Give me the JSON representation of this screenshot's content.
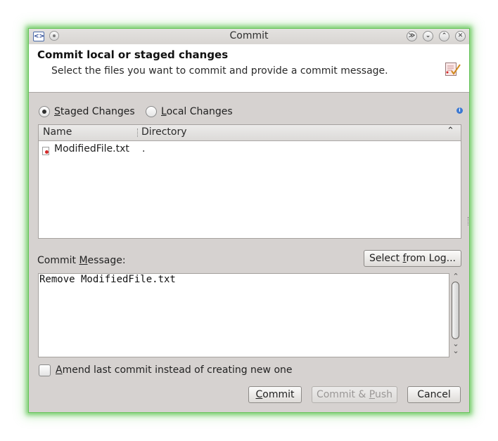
{
  "window": {
    "title": "Commit",
    "app_icon": "<>",
    "controls": {
      "keep_above": "≫",
      "keep_below": "⌄",
      "maximize": "⌃",
      "close": "✕"
    }
  },
  "header": {
    "title": "Commit local or staged changes",
    "description": "Select the files you want to commit and provide a commit message.",
    "icon": "commit-pen-icon"
  },
  "mode": {
    "staged": {
      "mnemonic": "S",
      "rest": "taged Changes",
      "checked": true
    },
    "local": {
      "mnemonic": "L",
      "rest": "ocal Changes",
      "checked": false
    },
    "info_icon": "i"
  },
  "files": {
    "columns": [
      "Name",
      "Directory"
    ],
    "sort_icon": "⌃",
    "rows": [
      {
        "name": "ModifiedFile.txt",
        "directory": "."
      }
    ]
  },
  "message": {
    "label_pre": "Commit ",
    "label_mnemonic": "M",
    "label_post": "essage:",
    "select_log_pre": "Select ",
    "select_log_mnemonic": "f",
    "select_log_post": "rom Log...",
    "value": "Remove ModifiedFile.txt",
    "scroll_up": "⌃",
    "scroll_down": "⌄\n⌄"
  },
  "amend": {
    "mnemonic": "A",
    "rest": "mend last commit instead of creating new one",
    "checked": false
  },
  "buttons": {
    "commit_mnemonic": "C",
    "commit_rest": "ommit",
    "commit_push_pre": "Commit & ",
    "commit_push_mnemonic": "P",
    "commit_push_post": "ush",
    "commit_push_disabled": true,
    "cancel": "Cancel"
  },
  "colors": {
    "focus_glow": "#5cc450",
    "info": "#3b78d2",
    "file_badge": "#d42a2a"
  }
}
